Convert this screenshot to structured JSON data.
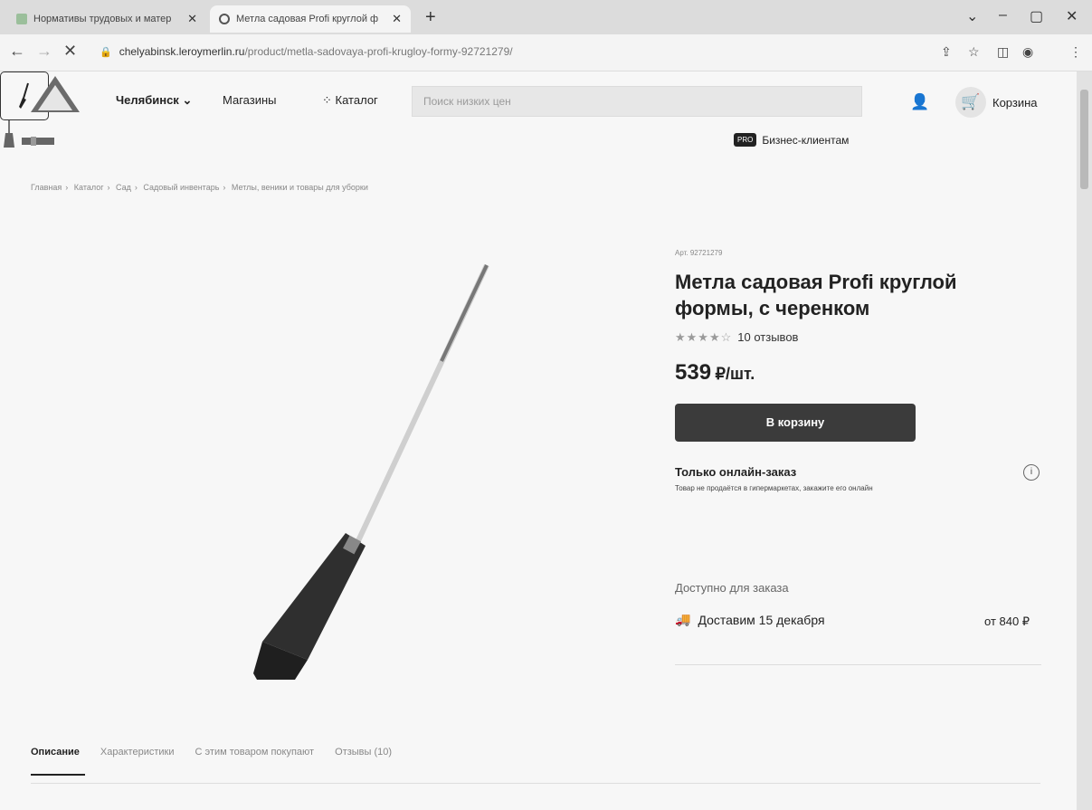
{
  "browser": {
    "tabs": [
      {
        "title": "Нормативы трудовых и матер"
      },
      {
        "title": "Метла садовая Profi круглой ф"
      }
    ],
    "url_host": "chelyabinsk.leroymerlin.ru",
    "url_path": "/product/metla-sadovaya-profi-krugloy-formy-92721279/"
  },
  "header": {
    "city": "Челябинск",
    "stores": "Магазины",
    "catalog": "Каталог",
    "search_placeholder": "Поиск низких цен",
    "cart": "Корзина",
    "pro_badge": "PRO",
    "business": "Бизнес-клиентам"
  },
  "breadcrumbs": [
    "Главная",
    "Каталог",
    "Сад",
    "Садовый инвентарь",
    "Метлы, веники и товары для уборки"
  ],
  "product": {
    "article": "Арт. 92721279",
    "title": "Метла садовая Profi круглой формы, с черенком",
    "stars": "★★★★☆",
    "rating": 4,
    "reviews": "10 отзывов",
    "price": "539",
    "price_unit": "₽/шт.",
    "add_to_cart": "В корзину",
    "online_only_title": "Только онлайн-заказ",
    "online_only_note": "Товар не продаётся в гипермаркетах, закажите его онлайн",
    "availability": "Доступно для заказа",
    "delivery": "Доставим 15 декабря",
    "delivery_price": "от 840 ₽"
  },
  "tabs": [
    "Описание",
    "Характеристики",
    "С этим товаром покупают",
    "Отзывы (10)"
  ],
  "colors": {
    "accent": "#3b3b3b",
    "page": "#f7f7f7"
  }
}
